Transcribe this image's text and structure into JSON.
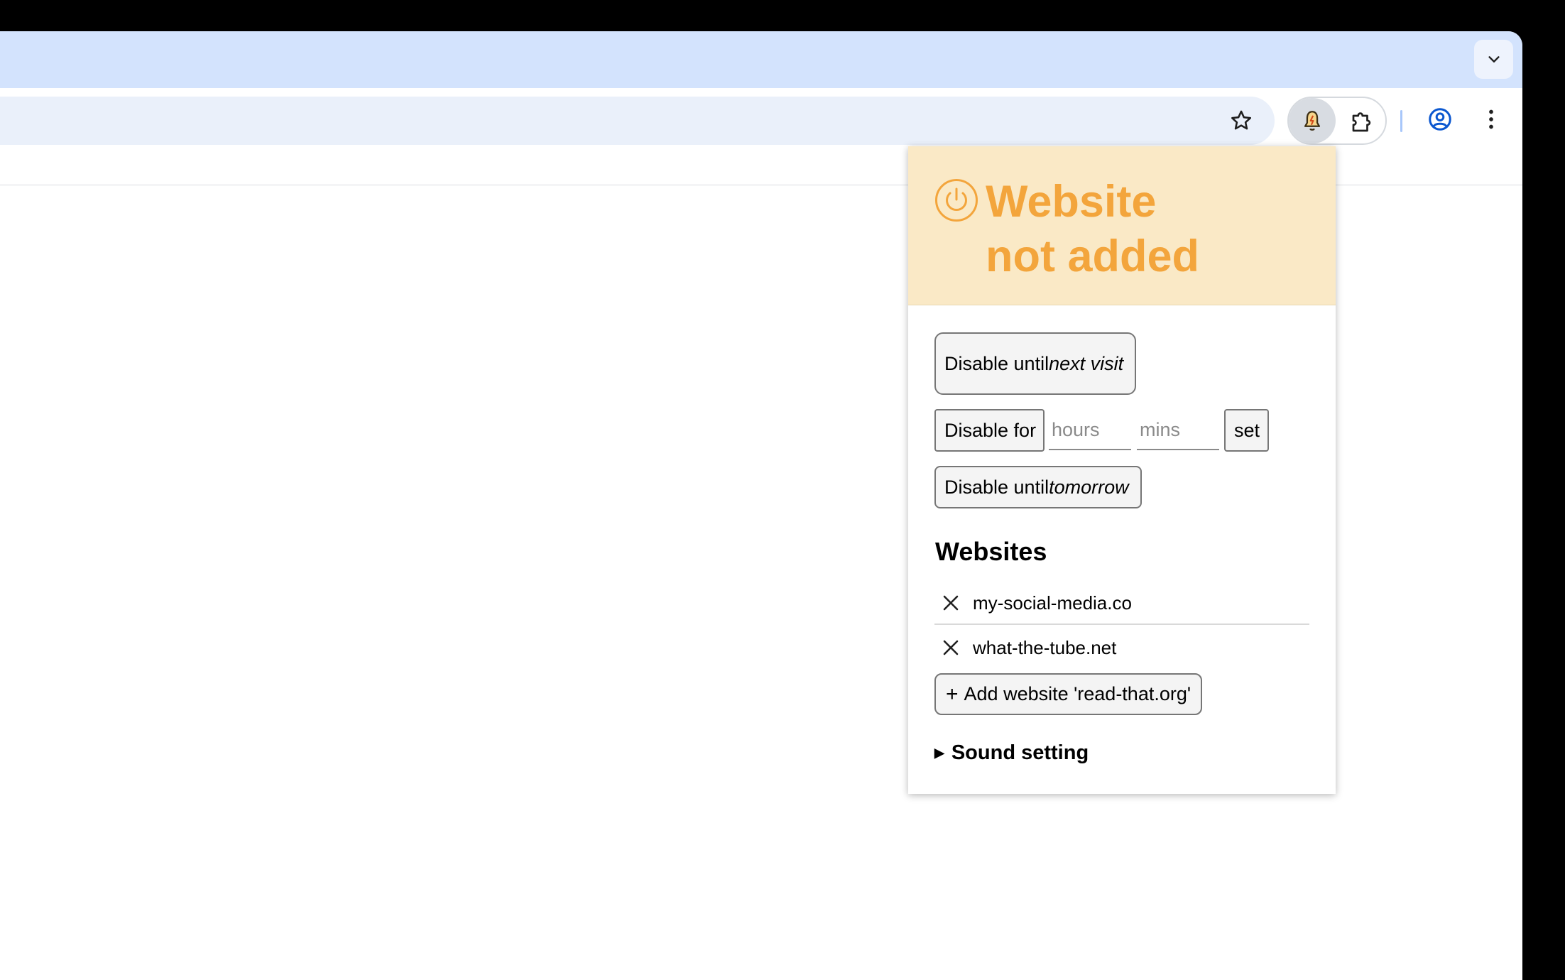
{
  "browser": {
    "icons": {
      "tab_search": "chevron-down-icon",
      "bookmark": "star-icon",
      "extension_active": "bell-icon",
      "extensions_menu": "puzzle-icon",
      "profile": "profile-icon",
      "menu": "more-vert-icon"
    }
  },
  "popup": {
    "status": {
      "line1": "Website",
      "line2": "not added",
      "color": "#f3a53c",
      "background": "#fae9c6"
    },
    "disable_next_visit": {
      "prefix": "Disable until ",
      "emphasis": "next visit"
    },
    "disable_for": {
      "label": "Disable for",
      "hours_placeholder": "hours",
      "mins_placeholder": "mins",
      "hours_value": "",
      "mins_value": "",
      "set_label": "set"
    },
    "disable_tomorrow": {
      "prefix": "Disable until ",
      "emphasis": "tomorrow"
    },
    "websites": {
      "title": "Websites",
      "items": [
        {
          "name": "my-social-media.co"
        },
        {
          "name": "what-the-tube.net"
        }
      ],
      "add_icon": "+",
      "add_label": "Add website 'read-that.org'"
    },
    "sound_setting": {
      "marker": "▶",
      "label": "Sound setting"
    }
  }
}
